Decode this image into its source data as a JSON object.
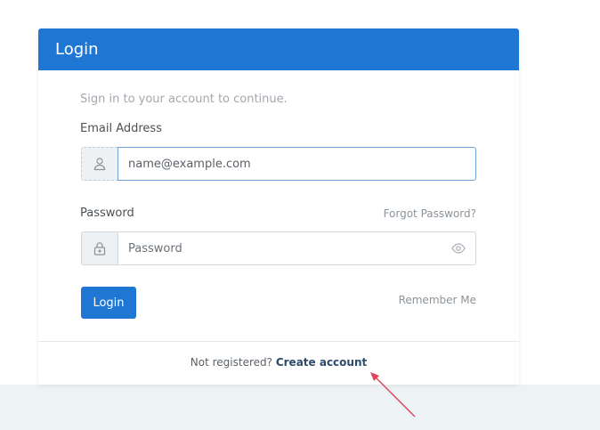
{
  "card": {
    "title": "Login",
    "subtitle": "Sign in to your account to continue."
  },
  "email": {
    "label": "Email Address",
    "placeholder": "name@example.com",
    "icon": "user-icon"
  },
  "password": {
    "label": "Password",
    "placeholder": "Password",
    "forgot_link": "Forgot Password?",
    "icon": "lock-icon",
    "toggle_icon": "eye-icon"
  },
  "actions": {
    "login_label": "Login",
    "remember_label": "Remember Me"
  },
  "footer": {
    "prompt": "Not registered?",
    "link": "Create account"
  },
  "colors": {
    "primary": "#1f77d3",
    "annotation_arrow": "#e0435a"
  }
}
